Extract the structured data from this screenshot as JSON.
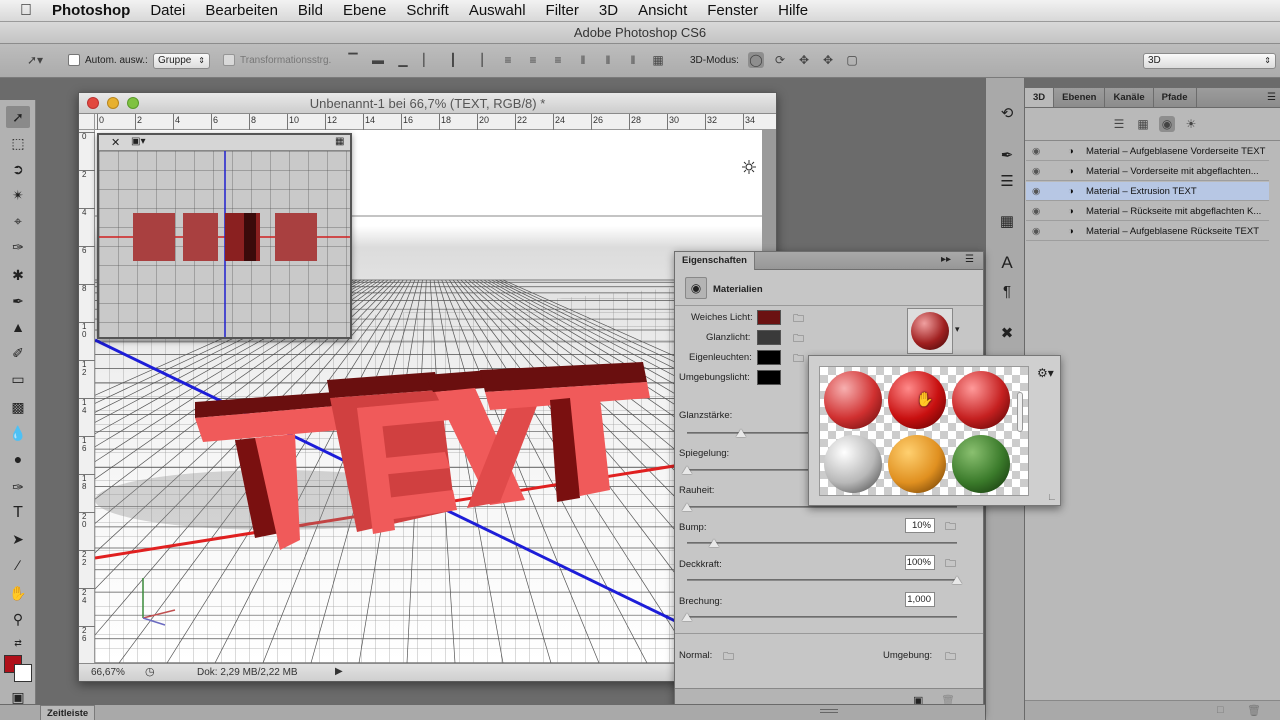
{
  "menubar": {
    "items": [
      "Photoshop",
      "Datei",
      "Bearbeiten",
      "Bild",
      "Ebene",
      "Schrift",
      "Auswahl",
      "Filter",
      "3D",
      "Ansicht",
      "Fenster",
      "Hilfe"
    ]
  },
  "app_title": "Adobe Photoshop CS6",
  "options": {
    "auto_select_label": "Autom. ausw.:",
    "auto_select_value": "Gruppe",
    "transform_label": "Transformationsstrg.",
    "mode_label": "3D-Modus:",
    "workspace_value": "3D"
  },
  "document": {
    "title": "Unbenannt-1 bei 66,7% (TEXT, RGB/8) *",
    "zoom": "66,67%",
    "doc_info": "Dok: 2,29 MB/2,22 MB",
    "ruler_top": [
      "0",
      "2",
      "4",
      "6",
      "8",
      "10",
      "12",
      "14",
      "16",
      "18",
      "20",
      "22",
      "24",
      "26",
      "28",
      "30",
      "32",
      "34"
    ],
    "ruler_left": [
      "0",
      "2",
      "4",
      "6",
      "8",
      "1\n0",
      "1\n2",
      "1\n4",
      "1\n6",
      "1\n8",
      "2\n0",
      "2\n2",
      "2\n4",
      "2\n6"
    ],
    "text_3d": "TEXT"
  },
  "panel3d": {
    "tabs": [
      "3D",
      "Ebenen",
      "Kanäle",
      "Pfade"
    ],
    "materials": [
      "Material – Aufgeblasene Vorderseite TEXT",
      "Material – Vorderseite mit abgeflachten...",
      "Material – Extrusion TEXT",
      "Material – Rückseite mit abgeflachten K...",
      "Material – Aufgeblasene Rückseite TEXT"
    ],
    "selected_index": 2
  },
  "properties": {
    "title": "Eigenschaften",
    "section": "Materialien",
    "weiches_licht": "Weiches Licht:",
    "glanzlicht": "Glanzlicht:",
    "eigenleuchten": "Eigenleuchten:",
    "umgebungslicht": "Umgebungslicht:",
    "glanzstaerke": "Glanzstärke:",
    "spiegelung": "Spiegelung:",
    "rauheit": "Rauheit:",
    "bump": "Bump:",
    "bump_value": "10%",
    "deckkraft": "Deckkraft:",
    "deckkraft_value": "100%",
    "brechung": "Brechung:",
    "brechung_value": "1,000",
    "normal": "Normal:",
    "umgebung": "Umgebung:",
    "colors": {
      "weiches_licht": "#6b1212",
      "glanzlicht": "#3a3a3a",
      "eigenleuchten": "#000000",
      "umgebungslicht": "#000000"
    },
    "sliders": {
      "glanzstaerke": 0.2,
      "spiegelung": 0.0,
      "rauheit": 0.0,
      "bump": 0.1,
      "deckkraft": 1.0,
      "brechung": 0.0
    }
  },
  "timeline_label": "Zeitleiste"
}
